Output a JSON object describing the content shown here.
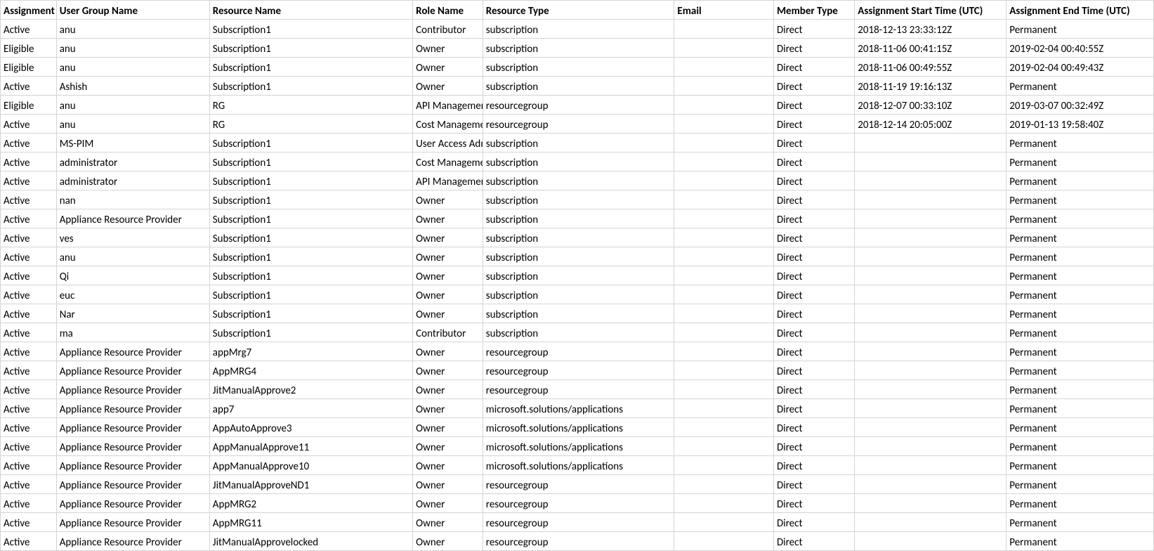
{
  "headers": {
    "assignment": "Assignment",
    "user_group": "User Group Name",
    "resource_name": "Resource Name",
    "role_name": "Role Name",
    "resource_type": "Resource Type",
    "email": "Email",
    "member_type": "Member Type",
    "start_time": "Assignment Start Time (UTC)",
    "end_time": "Assignment End Time (UTC)"
  },
  "rows": [
    {
      "assignment": "Active",
      "user_group": "anu",
      "resource_name": "Subscription1",
      "role_name": "Contributor",
      "resource_type": "subscription",
      "email": "",
      "member_type": "Direct",
      "start_time": "2018-12-13 23:33:12Z",
      "end_time": "Permanent"
    },
    {
      "assignment": "Eligible",
      "user_group": "anu",
      "resource_name": "Subscription1",
      "role_name": "Owner",
      "resource_type": "subscription",
      "email": "",
      "member_type": "Direct",
      "start_time": "2018-11-06 00:41:15Z",
      "end_time": "2019-02-04 00:40:55Z"
    },
    {
      "assignment": "Eligible",
      "user_group": "anu",
      "resource_name": "Subscription1",
      "role_name": "Owner",
      "resource_type": "subscription",
      "email": "",
      "member_type": "Direct",
      "start_time": "2018-11-06 00:49:55Z",
      "end_time": "2019-02-04 00:49:43Z"
    },
    {
      "assignment": "Active",
      "user_group": "Ashish",
      "resource_name": "Subscription1",
      "role_name": "Owner",
      "resource_type": "subscription",
      "email": "",
      "member_type": "Direct",
      "start_time": "2018-11-19 19:16:13Z",
      "end_time": "Permanent"
    },
    {
      "assignment": "Eligible",
      "user_group": "anu",
      "resource_name": "RG",
      "role_name": "API Management",
      "resource_type": "resourcegroup",
      "email": "",
      "member_type": "Direct",
      "start_time": "2018-12-07 00:33:10Z",
      "end_time": "2019-03-07 00:32:49Z"
    },
    {
      "assignment": "Active",
      "user_group": "anu",
      "resource_name": "RG",
      "role_name": "Cost Management",
      "resource_type": "resourcegroup",
      "email": "",
      "member_type": "Direct",
      "start_time": "2018-12-14 20:05:00Z",
      "end_time": "2019-01-13 19:58:40Z"
    },
    {
      "assignment": "Active",
      "user_group": "MS-PIM",
      "resource_name": "Subscription1",
      "role_name": "User Access Administrator",
      "resource_type": "subscription",
      "email": "",
      "member_type": "Direct",
      "start_time": "",
      "end_time": "Permanent"
    },
    {
      "assignment": "Active",
      "user_group": "administrator",
      "resource_name": "Subscription1",
      "role_name": "Cost Management",
      "resource_type": "subscription",
      "email": "",
      "member_type": "Direct",
      "start_time": "",
      "end_time": "Permanent"
    },
    {
      "assignment": "Active",
      "user_group": "administrator",
      "resource_name": "Subscription1",
      "role_name": "API Management",
      "resource_type": "subscription",
      "email": "",
      "member_type": "Direct",
      "start_time": "",
      "end_time": "Permanent"
    },
    {
      "assignment": "Active",
      "user_group": "nan",
      "resource_name": "Subscription1",
      "role_name": "Owner",
      "resource_type": "subscription",
      "email": "",
      "member_type": "Direct",
      "start_time": "",
      "end_time": "Permanent"
    },
    {
      "assignment": "Active",
      "user_group": "Appliance Resource Provider",
      "resource_name": "Subscription1",
      "role_name": "Owner",
      "resource_type": "subscription",
      "email": "",
      "member_type": "Direct",
      "start_time": "",
      "end_time": "Permanent"
    },
    {
      "assignment": "Active",
      "user_group": "ves",
      "resource_name": "Subscription1",
      "role_name": "Owner",
      "resource_type": "subscription",
      "email": "",
      "member_type": "Direct",
      "start_time": "",
      "end_time": "Permanent"
    },
    {
      "assignment": "Active",
      "user_group": "anu",
      "resource_name": "Subscription1",
      "role_name": "Owner",
      "resource_type": "subscription",
      "email": "",
      "member_type": "Direct",
      "start_time": "",
      "end_time": "Permanent"
    },
    {
      "assignment": "Active",
      "user_group": "Qi",
      "resource_name": "Subscription1",
      "role_name": "Owner",
      "resource_type": "subscription",
      "email": "",
      "member_type": "Direct",
      "start_time": "",
      "end_time": "Permanent"
    },
    {
      "assignment": "Active",
      "user_group": "euc",
      "resource_name": "Subscription1",
      "role_name": "Owner",
      "resource_type": "subscription",
      "email": "",
      "member_type": "Direct",
      "start_time": "",
      "end_time": "Permanent"
    },
    {
      "assignment": "Active",
      "user_group": "Nar",
      "resource_name": "Subscription1",
      "role_name": "Owner",
      "resource_type": "subscription",
      "email": "",
      "member_type": "Direct",
      "start_time": "",
      "end_time": "Permanent"
    },
    {
      "assignment": "Active",
      "user_group": "ma",
      "resource_name": "Subscription1",
      "role_name": "Contributor",
      "resource_type": "subscription",
      "email": "",
      "member_type": "Direct",
      "start_time": "",
      "end_time": "Permanent"
    },
    {
      "assignment": "Active",
      "user_group": "Appliance Resource Provider",
      "resource_name": "appMrg7",
      "role_name": "Owner",
      "resource_type": "resourcegroup",
      "email": "",
      "member_type": "Direct",
      "start_time": "",
      "end_time": "Permanent"
    },
    {
      "assignment": "Active",
      "user_group": "Appliance Resource Provider",
      "resource_name": "AppMRG4",
      "role_name": "Owner",
      "resource_type": "resourcegroup",
      "email": "",
      "member_type": "Direct",
      "start_time": "",
      "end_time": "Permanent"
    },
    {
      "assignment": "Active",
      "user_group": "Appliance Resource Provider",
      "resource_name": "JitManualApprove2",
      "role_name": "Owner",
      "resource_type": "resourcegroup",
      "email": "",
      "member_type": "Direct",
      "start_time": "",
      "end_time": "Permanent"
    },
    {
      "assignment": "Active",
      "user_group": "Appliance Resource Provider",
      "resource_name": "app7",
      "role_name": "Owner",
      "resource_type": "microsoft.solutions/applications",
      "email": "",
      "member_type": "Direct",
      "start_time": "",
      "end_time": "Permanent"
    },
    {
      "assignment": "Active",
      "user_group": "Appliance Resource Provider",
      "resource_name": "AppAutoApprove3",
      "role_name": "Owner",
      "resource_type": "microsoft.solutions/applications",
      "email": "",
      "member_type": "Direct",
      "start_time": "",
      "end_time": "Permanent"
    },
    {
      "assignment": "Active",
      "user_group": "Appliance Resource Provider",
      "resource_name": "AppManualApprove11",
      "role_name": "Owner",
      "resource_type": "microsoft.solutions/applications",
      "email": "",
      "member_type": "Direct",
      "start_time": "",
      "end_time": "Permanent"
    },
    {
      "assignment": "Active",
      "user_group": "Appliance Resource Provider",
      "resource_name": "AppManualApprove10",
      "role_name": "Owner",
      "resource_type": "microsoft.solutions/applications",
      "email": "",
      "member_type": "Direct",
      "start_time": "",
      "end_time": "Permanent"
    },
    {
      "assignment": "Active",
      "user_group": "Appliance Resource Provider",
      "resource_name": "JitManualApproveND1",
      "role_name": "Owner",
      "resource_type": "resourcegroup",
      "email": "",
      "member_type": "Direct",
      "start_time": "",
      "end_time": "Permanent"
    },
    {
      "assignment": "Active",
      "user_group": "Appliance Resource Provider",
      "resource_name": "AppMRG2",
      "role_name": "Owner",
      "resource_type": "resourcegroup",
      "email": "",
      "member_type": "Direct",
      "start_time": "",
      "end_time": "Permanent"
    },
    {
      "assignment": "Active",
      "user_group": "Appliance Resource Provider",
      "resource_name": "AppMRG11",
      "role_name": "Owner",
      "resource_type": "resourcegroup",
      "email": "",
      "member_type": "Direct",
      "start_time": "",
      "end_time": "Permanent"
    },
    {
      "assignment": "Active",
      "user_group": "Appliance Resource Provider",
      "resource_name": "JitManualApprovelocked",
      "role_name": "Owner",
      "resource_type": "resourcegroup",
      "email": "",
      "member_type": "Direct",
      "start_time": "",
      "end_time": "Permanent"
    }
  ]
}
